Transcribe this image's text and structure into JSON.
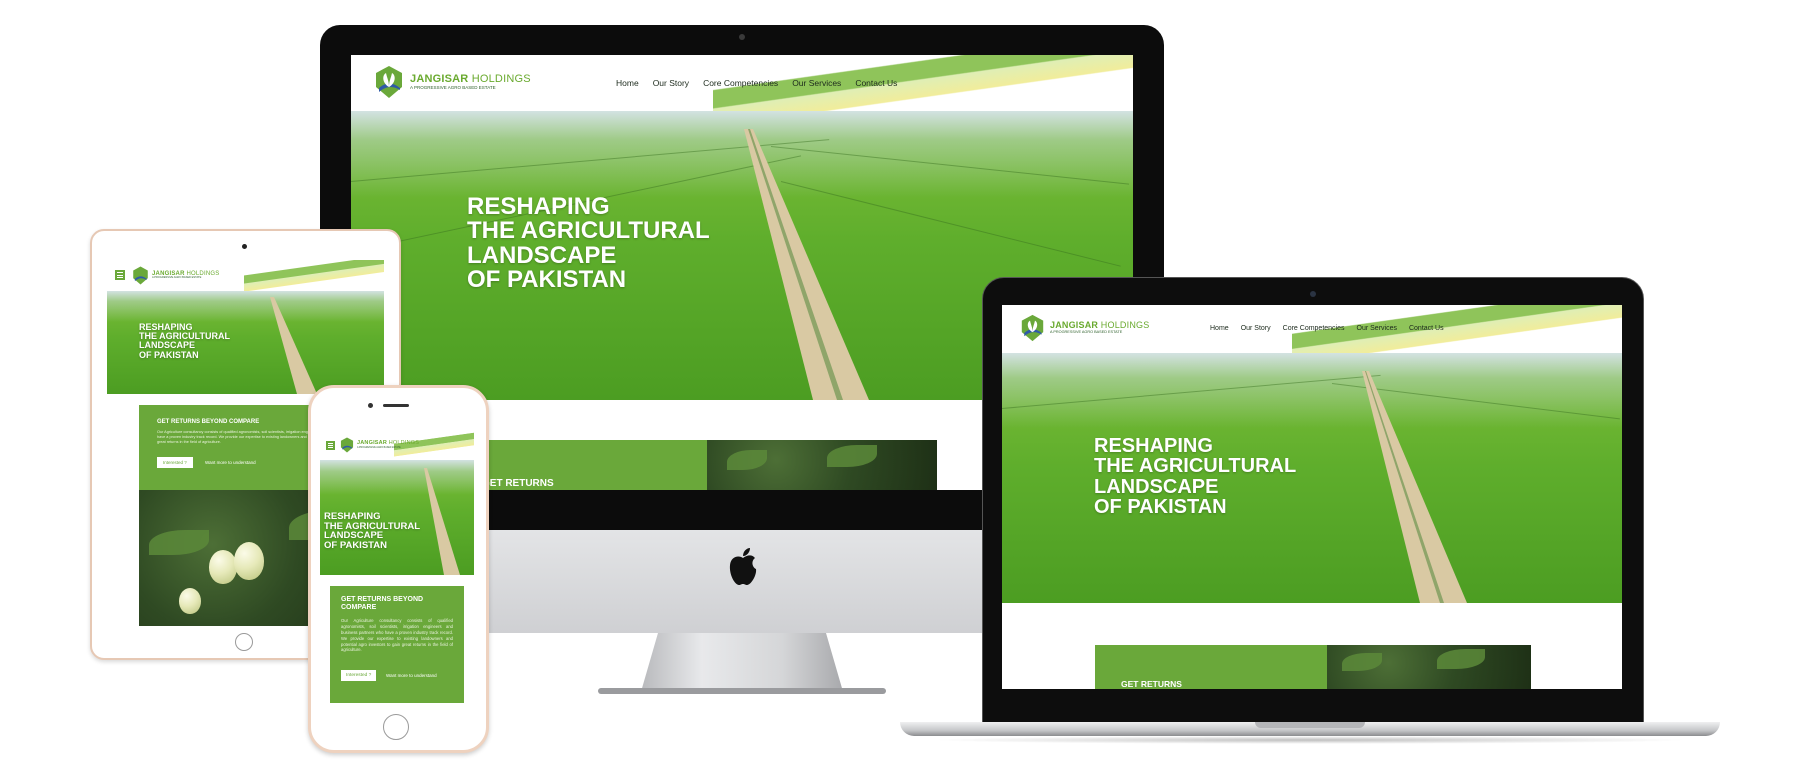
{
  "brand": {
    "name_part1": "JANGISAR",
    "name_part2": " HOLDINGS",
    "tagline": "A PROGRESSIVE AGRO BASED ESTATE"
  },
  "nav": [
    "Home",
    "Our Story",
    "Core Competencies",
    "Our Services",
    "Contact Us"
  ],
  "hero": {
    "line1": "RESHAPING",
    "line2": "THE AGRICULTURAL",
    "line3": "LANDSCAPE",
    "line4": "OF PAKISTAN"
  },
  "section": {
    "heading": "GET RETURNS BEYOND COMPARE",
    "heading_line1": "GET RETURNS BEYOND",
    "heading_line2": "COMPARE",
    "heading_cut": "GET RETURNS",
    "body": "Our Agriculture consultancy consists of qualified agronomists, soil scientists, irrigation engineers and business partners who have a proven industry track record. We provide our expertise to existing landowners and potential agro investors to gain great returns in the field of agriculture.",
    "btn_primary": "Interested ?",
    "btn_secondary": "Want more to understand"
  },
  "colors": {
    "brand_green": "#6aa83a",
    "field_green": "#5fae2c",
    "stripe_yellow": "#f1ed9b",
    "stripe_light": "#dfeeb5"
  },
  "icons": {
    "menu": "hamburger-menu-icon",
    "logo": "leaf-shield-logo-icon",
    "device_brand": "apple-logo-icon"
  }
}
